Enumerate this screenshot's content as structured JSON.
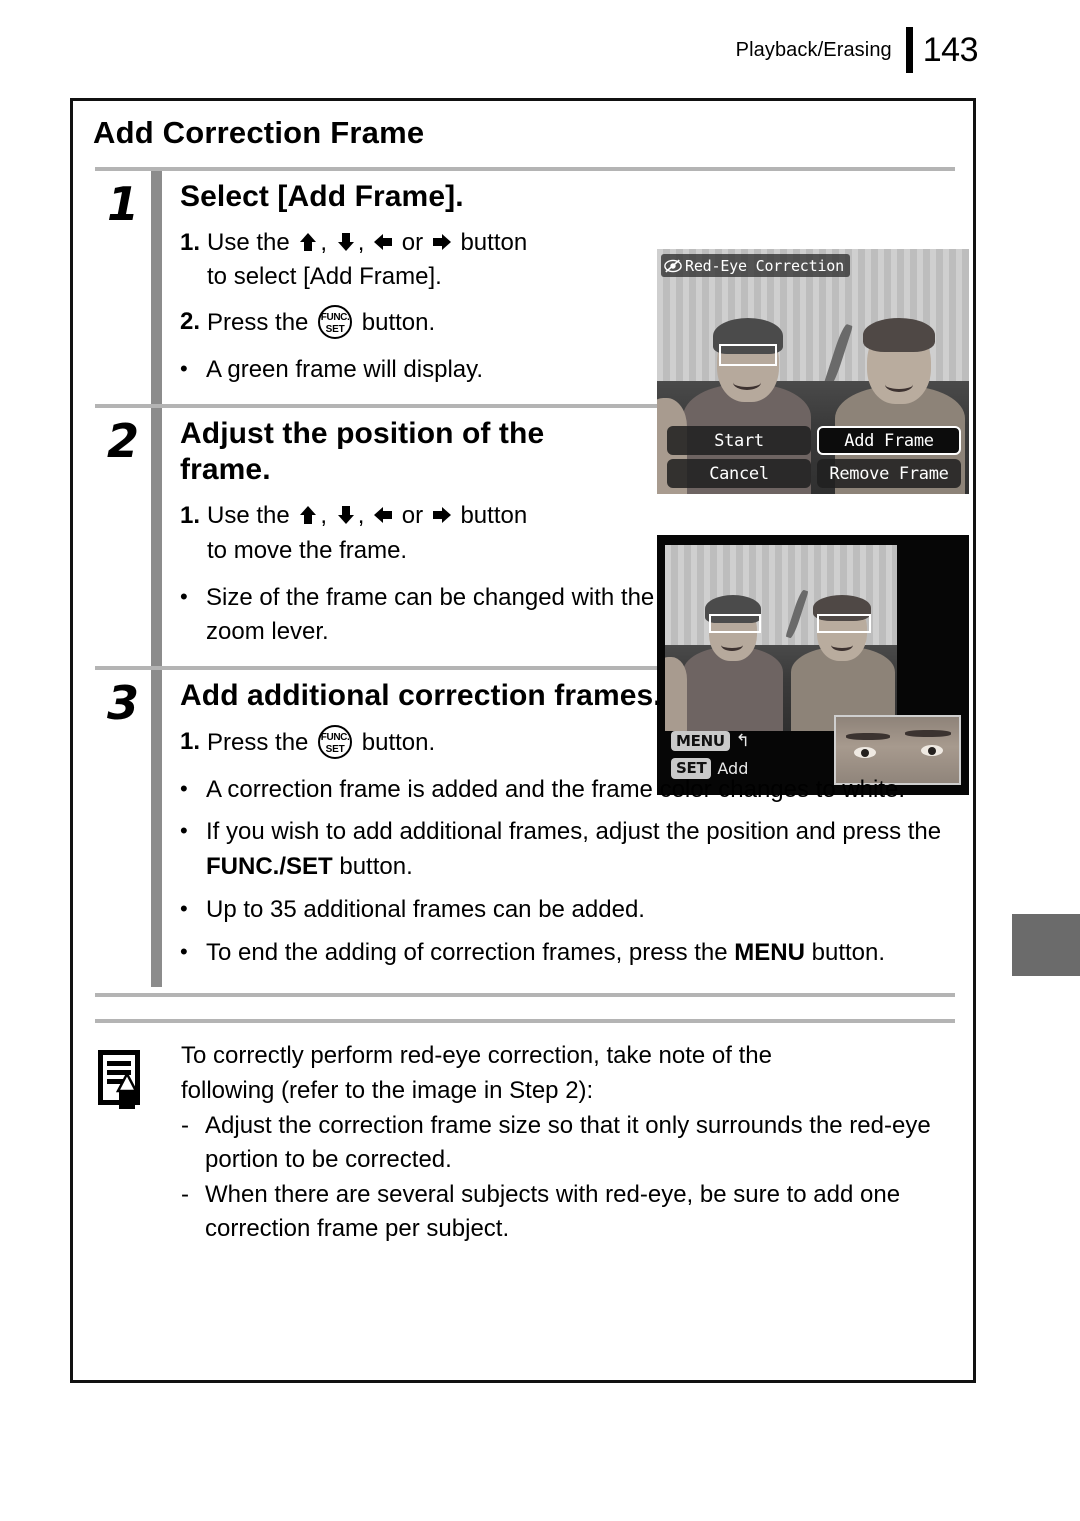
{
  "header": {
    "section": "Playback/Erasing",
    "page_number": "143"
  },
  "section_title": "Add Correction Frame",
  "steps": [
    {
      "number": "1",
      "heading": "Select [Add Frame].",
      "items": [
        {
          "marker": "1.",
          "prefix": "Use the",
          "suffix": "button",
          "icons": [
            "arrow-up",
            "arrow-down",
            "arrow-left",
            "arrow-right"
          ],
          "continuation": "to select [Add Frame]."
        },
        {
          "marker": "2.",
          "prefix": "Press the",
          "suffix": "button.",
          "icon": "func-set"
        }
      ],
      "bullets": [
        {
          "marker": "•",
          "text": "A green frame will display."
        }
      ]
    },
    {
      "number": "2",
      "heading": "Adjust the position of the frame.",
      "items": [
        {
          "marker": "1.",
          "prefix": "Use the",
          "suffix": "button",
          "icons": [
            "arrow-up",
            "arrow-down",
            "arrow-left",
            "arrow-right"
          ],
          "continuation": "to move the frame."
        }
      ],
      "bullets": [
        {
          "marker": "•",
          "text": "Size of the frame can be changed with the zoom lever."
        }
      ]
    },
    {
      "number": "3",
      "heading": "Add additional correction frames.",
      "items": [
        {
          "marker": "1.",
          "prefix": "Press the",
          "suffix": "button.",
          "icon": "func-set"
        }
      ],
      "bullets": [
        {
          "marker": "•",
          "text": "A correction frame is added and the frame color changes to white."
        },
        {
          "marker": "•",
          "text_before": "If you wish to add additional frames, adjust the position and press the ",
          "bold": "FUNC./SET",
          "text_after": " button."
        },
        {
          "marker": "•",
          "text": "Up to 35 additional frames can be added."
        },
        {
          "marker": "•",
          "text_before": "To end the adding of correction frames, press the ",
          "bold": "MENU",
          "text_after": " button."
        }
      ]
    }
  ],
  "screens": [
    {
      "name": "red-eye-correction-menu",
      "title": "Red-Eye Correction",
      "title_icon": "red-eye-icon",
      "buttons": [
        {
          "label": "Start",
          "selected": false
        },
        {
          "label": "Add Frame",
          "selected": true
        },
        {
          "label": "Cancel",
          "selected": false
        },
        {
          "label": "Remove Frame",
          "selected": false
        }
      ]
    },
    {
      "name": "frame-adjust-screen",
      "hints": [
        {
          "badge": "MENU",
          "glyph": "↰",
          "label": ""
        },
        {
          "badge": "SET",
          "label": "Add"
        }
      ]
    }
  ],
  "note": {
    "icon": "note-pencil-icon",
    "intro_line_1": "To correctly perform red-eye correction, take note of the",
    "intro_line_2": "following (refer to the image in Step 2):",
    "items": [
      {
        "marker": "-",
        "text": "Adjust the correction frame size so that it only surrounds the red-eye portion to be corrected."
      },
      {
        "marker": "-",
        "text": "When there are several subjects with red-eye, be sure to add one correction frame per subject."
      }
    ]
  },
  "colors": {
    "step_bar": "#8c8c8c",
    "rule": "#b4b4b4",
    "thumb_tab": "#6b6b6b",
    "border": "#111111"
  }
}
